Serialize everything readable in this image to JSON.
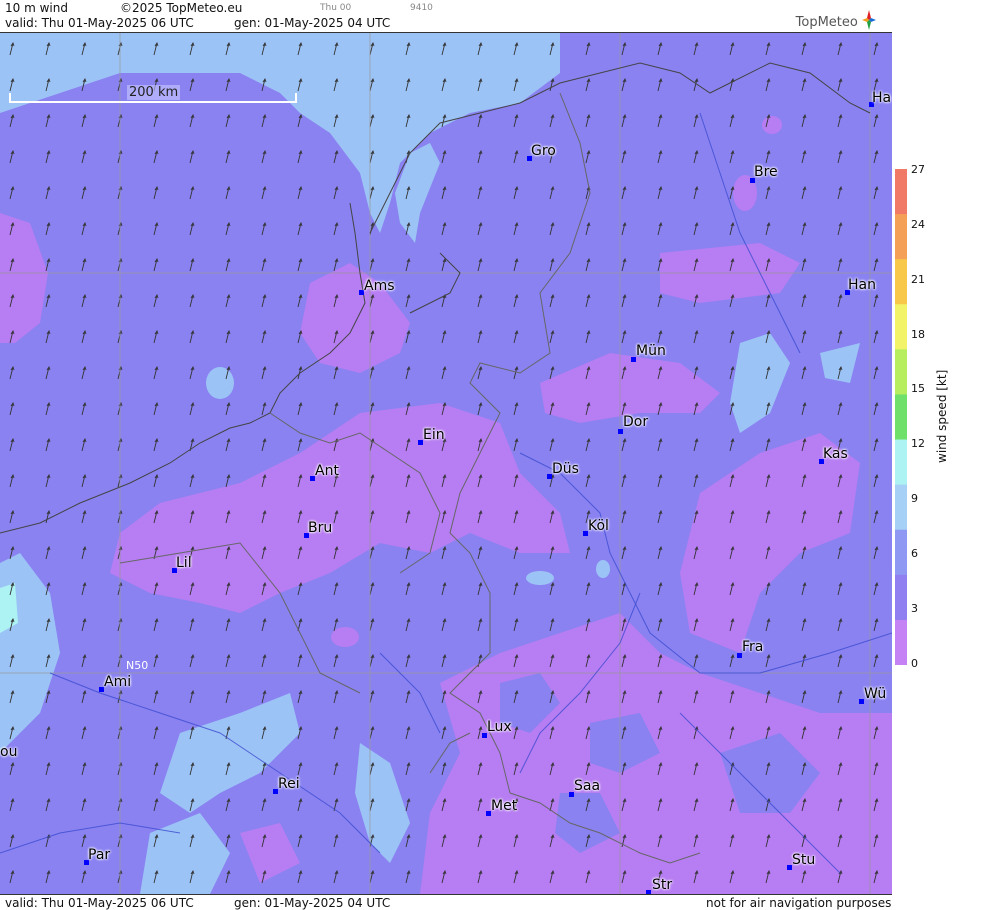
{
  "header": {
    "product": "10 m wind",
    "copyright": "©2025 TopMeteo.eu",
    "valid_label": "valid:  Thu  01-May-2025  06 UTC",
    "gen_label": "gen: 01-May-2025 04 UTC",
    "day_code": "Thu 00",
    "code": "9410",
    "brand": "TopMeteo"
  },
  "footer": {
    "valid_label": "valid:  Thu  01-May-2025  06 UTC",
    "gen_label": "gen: 01-May-2025 04 UTC",
    "disclaimer": "not for air navigation purposes"
  },
  "map": {
    "scale_label": "200 km",
    "lat_label": "N50",
    "cities": [
      {
        "name": "Ha"
      },
      {
        "name": "Gro"
      },
      {
        "name": "Bre"
      },
      {
        "name": "Han"
      },
      {
        "name": "Ams"
      },
      {
        "name": "Mün"
      },
      {
        "name": "Dor"
      },
      {
        "name": "Ein"
      },
      {
        "name": "Kas"
      },
      {
        "name": "Düs"
      },
      {
        "name": "Ant"
      },
      {
        "name": "Köl"
      },
      {
        "name": "Bru"
      },
      {
        "name": "Lil"
      },
      {
        "name": "Fra"
      },
      {
        "name": "Ami"
      },
      {
        "name": "Wü"
      },
      {
        "name": "Lux"
      },
      {
        "name": "ou"
      },
      {
        "name": "Rei"
      },
      {
        "name": "Saa"
      },
      {
        "name": "Met"
      },
      {
        "name": "Par"
      },
      {
        "name": "Stu"
      },
      {
        "name": "Str"
      }
    ]
  },
  "legend": {
    "title": "wind speed [kt]",
    "ticks": [
      "27",
      "24",
      "21",
      "18",
      "15",
      "12",
      "9",
      "6",
      "3",
      "0"
    ],
    "colors": [
      "#f07a66",
      "#f5a057",
      "#f8c84a",
      "#f3f36a",
      "#b7ee60",
      "#6fe06a",
      "#aef3f3",
      "#a6d0f5",
      "#8f99f3",
      "#8f7ff0",
      "#c482f4"
    ]
  },
  "palette": {
    "calm_violet": "#b77df2",
    "light_blue": "#9cc3f6",
    "base_blue": "#8a82f1",
    "mid_blue": "#8f96f2"
  }
}
